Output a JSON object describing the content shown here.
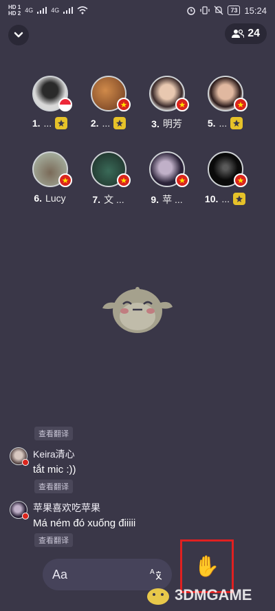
{
  "status_bar": {
    "hd1": "HD 1",
    "hd2": "HD 2",
    "net1": "4G",
    "net2": "4G",
    "battery": "73",
    "time": "15:24"
  },
  "header": {
    "member_count": "24"
  },
  "seats": [
    {
      "num": "1.",
      "name": "...",
      "flag": "sg",
      "avatar_color": "#c9c9c9"
    },
    {
      "num": "2.",
      "name": "...",
      "flag": "vn",
      "avatar_color": "#a0522d"
    },
    {
      "num": "3.",
      "name": "明芳",
      "flag": "vn",
      "avatar_color": "#d8cfc4"
    },
    {
      "num": "5.",
      "name": "...",
      "flag": "vn",
      "avatar_color": "#8a5a4a"
    },
    {
      "num": "6.",
      "name": "Lucy",
      "flag": "vn",
      "avatar_color": "#8a9a8a"
    },
    {
      "num": "7.",
      "name": "文 ...",
      "flag": "vn",
      "avatar_color": "#4a5a52"
    },
    {
      "num": "9.",
      "name": "苹 ...",
      "flag": "vn",
      "avatar_color": "#2a2a38"
    },
    {
      "num": "10.",
      "name": "...",
      "flag": "vn",
      "avatar_color": "#111111"
    }
  ],
  "chat": {
    "translate_label": "查看翻译",
    "messages": [
      {
        "user": "Keira清心",
        "text": "tắt mic :))"
      },
      {
        "user": "苹果喜欢吃苹果",
        "text": "Má ném đó xuống điiiii"
      }
    ]
  },
  "input": {
    "placeholder": "Aa"
  },
  "raise_hand": {
    "emoji": "✋"
  },
  "watermark": {
    "text": "3DMGAME"
  },
  "colors": {
    "background": "#3a3748",
    "gold_badge": "#e6c229",
    "vn_red": "#da251d",
    "highlight_box": "#e02020"
  }
}
